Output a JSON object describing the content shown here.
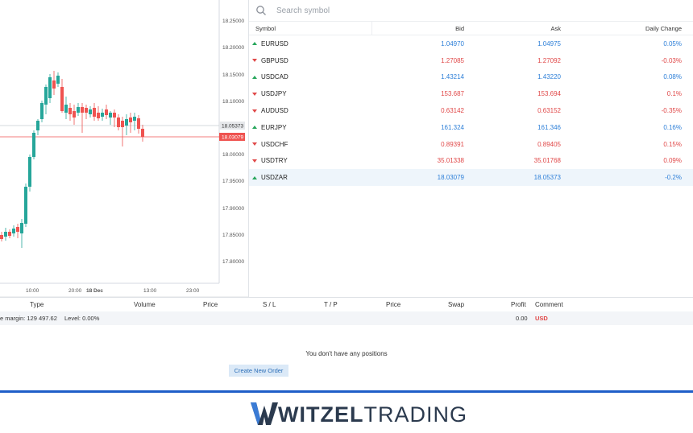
{
  "chart": {
    "price_scale": [
      "18.25000",
      "18.20000",
      "18.15000",
      "18.10000",
      "18.05000",
      "18.00000",
      "17.95000",
      "17.90000",
      "17.85000",
      "17.80000"
    ],
    "time_scale": [
      "10:00",
      "20:00",
      "18 Dec",
      "13:00",
      "23:00"
    ],
    "ask_tag": "18.05373",
    "bid_tag": "18.03079",
    "colors": {
      "up": "#26a69a",
      "down": "#ef5350",
      "bid_line": "#ef5350",
      "ask_line": "#9aa0a6"
    }
  },
  "watchlist": {
    "search_placeholder": "Search symbol",
    "headers": {
      "symbol": "Symbol",
      "bid": "Bid",
      "ask": "Ask",
      "change": "Daily Change"
    },
    "rows": [
      {
        "symbol": "EURUSD",
        "bid": "1.04970",
        "ask": "1.04975",
        "change": "0.05%",
        "dir": "up"
      },
      {
        "symbol": "GBPUSD",
        "bid": "1.27085",
        "ask": "1.27092",
        "change": "-0.03%",
        "dir": "down"
      },
      {
        "symbol": "USDCAD",
        "bid": "1.43214",
        "ask": "1.43220",
        "change": "0.08%",
        "dir": "up"
      },
      {
        "symbol": "USDJPY",
        "bid": "153.687",
        "ask": "153.694",
        "change": "0.1%",
        "dir": "down"
      },
      {
        "symbol": "AUDUSD",
        "bid": "0.63142",
        "ask": "0.63152",
        "change": "-0.35%",
        "dir": "down"
      },
      {
        "symbol": "EURJPY",
        "bid": "161.324",
        "ask": "161.346",
        "change": "0.16%",
        "dir": "up"
      },
      {
        "symbol": "USDCHF",
        "bid": "0.89391",
        "ask": "0.89405",
        "change": "0.15%",
        "dir": "down"
      },
      {
        "symbol": "USDTRY",
        "bid": "35.01338",
        "ask": "35.01768",
        "change": "0.09%",
        "dir": "down"
      },
      {
        "symbol": "USDZAR",
        "bid": "18.03079",
        "ask": "18.05373",
        "change": "-0.2%",
        "dir": "up"
      }
    ]
  },
  "positions": {
    "headers": {
      "type": "Type",
      "volume": "Volume",
      "price": "Price",
      "sl": "S / L",
      "tp": "T / P",
      "price2": "Price",
      "swap": "Swap",
      "profit": "Profit",
      "comment": "Comment"
    },
    "margin_text": "e margin: 129 497.62",
    "level_text": "Level: 0.00%",
    "profit_value": "0.00",
    "currency": "USD",
    "empty_text": "You don't have any positions",
    "create_button": "Create New Order"
  },
  "brand": {
    "part1": "WITZEL",
    "part2": "TRADING"
  }
}
